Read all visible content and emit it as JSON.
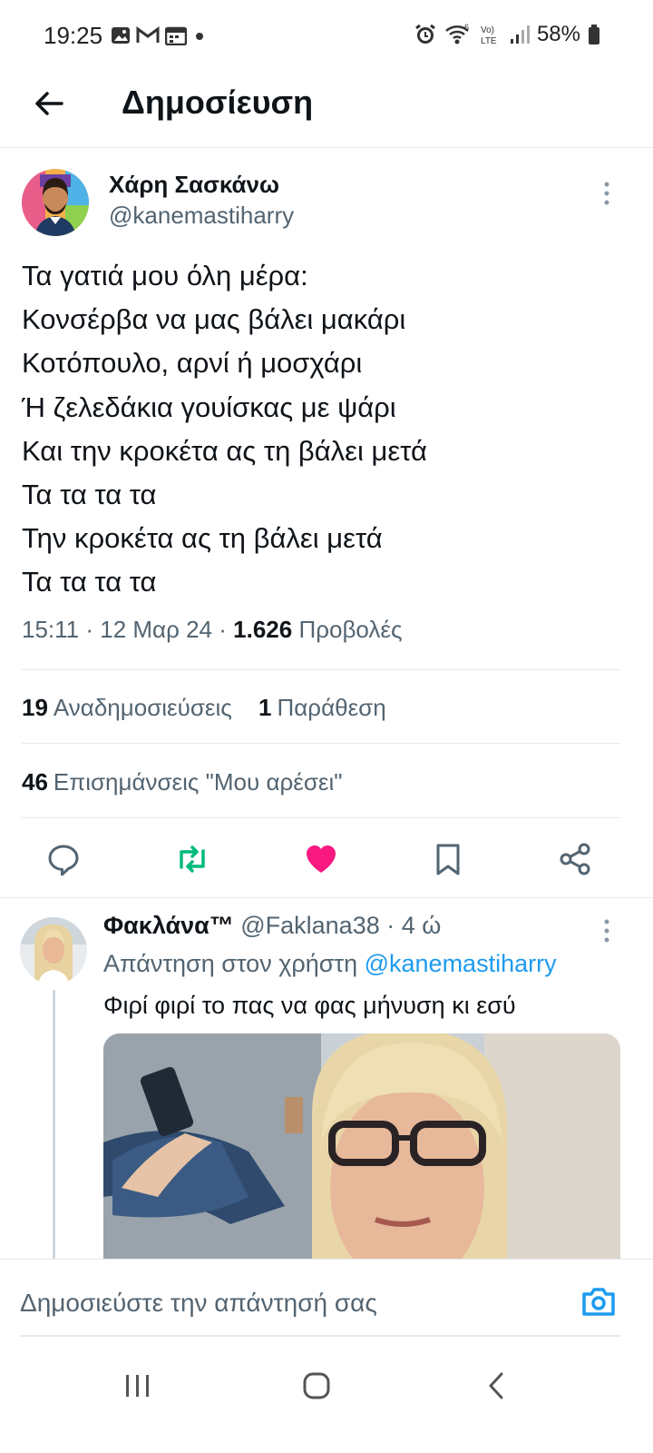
{
  "status_bar": {
    "time": "19:25",
    "battery": "58%",
    "icons": [
      "gallery-icon",
      "gmail-icon",
      "calendar-icon",
      "dot-icon",
      "alarm-icon",
      "wifi-icon",
      "volte-icon",
      "signal-icon",
      "battery-icon"
    ]
  },
  "header": {
    "title": "Δημοσίευση"
  },
  "tweet": {
    "author": {
      "name": "Χάρη Σασκάνω",
      "handle": "@kanemastiharry"
    },
    "lines": [
      "Τα γατιά μου όλη μέρα:",
      "Κονσέρβα να μας βάλει μακάρι",
      "Κοτόπουλο, αρνί ή μοσχάρι",
      "Ή ζελεδάκια γουίσκας με ψάρι",
      "Και την κροκέτα ας τη βάλει μετά",
      "Τα τα τα τα",
      "Την κροκέτα ας τη βάλει μετά",
      "Τα τα τα τα"
    ],
    "time": "15:11",
    "date": "12 Μαρ 24",
    "views_count": "1.626",
    "views_label": "Προβολές",
    "reposts_count": "19",
    "reposts_label": "Αναδημοσιεύσεις",
    "quotes_count": "1",
    "quotes_label": "Παράθεση",
    "likes_count": "46",
    "likes_label": "Επισημάνσεις \"Μου αρέσει\""
  },
  "colors": {
    "accent": "#1d9bf0",
    "repost": "#00ba7c",
    "like": "#f91880",
    "muted": "#536471",
    "text": "#0f1419"
  },
  "reply": {
    "name": "Φακλάνα™",
    "handle": "@Faklana38",
    "age": "4 ώ",
    "reply_to_label": "Απάντηση στον χρήστη",
    "reply_to_handle": "@kanemastiharry",
    "text": "Φιρί φιρί το πας να φας μήνυση κι εσύ"
  },
  "composer": {
    "placeholder": "Δημοσιεύστε την απάντησή σας"
  }
}
